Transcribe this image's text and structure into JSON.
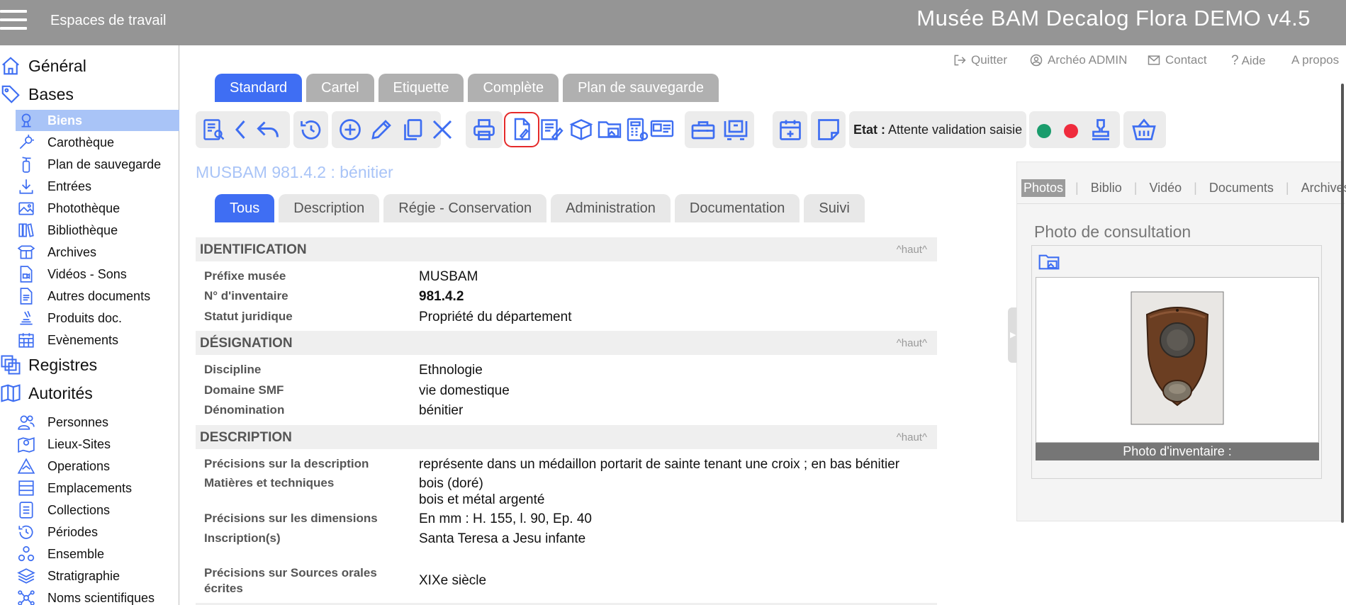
{
  "header": {
    "workspaces_label": "Espaces de travail",
    "app_title": "Musée BAM Decalog Flora DEMO v4.5"
  },
  "sidebar": {
    "general": "Général",
    "bases": "Bases",
    "bases_items": [
      "Biens",
      "Carothèque",
      "Plan de sauvegarde",
      "Entrées",
      "Photothèque",
      "Bibliothèque",
      "Archives",
      "Vidéos - Sons",
      "Autres documents",
      "Produits doc.",
      "Evènements"
    ],
    "registres": "Registres",
    "autorites": "Autorités",
    "autorites_items": [
      "Personnes",
      "Lieux-Sites",
      "Operations",
      "Emplacements",
      "Collections",
      "Périodes",
      "Ensemble",
      "Stratigraphie",
      "Noms scientifiques"
    ],
    "active_item": "Biens"
  },
  "toplinks": {
    "quit": "Quitter",
    "user": "Archéo ADMIN",
    "contact": "Contact",
    "help": "Aide",
    "about": "A propos"
  },
  "main_tabs": [
    "Standard",
    "Cartel",
    "Etiquette",
    "Complète",
    "Plan de sauvegarde"
  ],
  "main_tab_active": "Standard",
  "etat": {
    "label": "Etat :",
    "value": "Attente validation saisie"
  },
  "status_colors": {
    "green": "#1a9c6c",
    "red": "#ef2b3d",
    "accent": "#3f6ef3"
  },
  "record_title": "MUSBAM 981.4.2 : bénitier",
  "sub_tabs": [
    "Tous",
    "Description",
    "Régie - Conservation",
    "Administration",
    "Documentation",
    "Suivi"
  ],
  "sub_tab_active": "Tous",
  "haut_label": "^haut^",
  "sections": {
    "identification": {
      "title": "IDENTIFICATION",
      "rows": [
        {
          "label": "Préfixe musée",
          "value": "MUSBAM"
        },
        {
          "label": "N° d'inventaire",
          "value": "981.4.2"
        },
        {
          "label": "Statut juridique",
          "value": "Propriété du département"
        }
      ]
    },
    "designation": {
      "title": "DÉSIGNATION",
      "rows": [
        {
          "label": "Discipline",
          "value": "Ethnologie"
        },
        {
          "label": "Domaine SMF",
          "value": "vie domestique"
        },
        {
          "label": "Dénomination",
          "value": "bénitier"
        }
      ]
    },
    "description": {
      "title": "DESCRIPTION",
      "rows": [
        {
          "label": "Précisions sur la description",
          "value": "représente dans un médaillon portarit de sainte tenant une croix ; en bas bénitier"
        },
        {
          "label": "Matières et techniques",
          "value": "bois (doré)",
          "value2": "bois et métal argenté"
        },
        {
          "label": "Précisions sur les dimensions",
          "value": "En mm : H. 155, l. 90, Ep. 40"
        },
        {
          "label": "Inscription(s)",
          "value": "Santa Teresa a Jesu infante"
        },
        {
          "label": "Précisions sur Sources orales écrites",
          "value": "XIXe siècle"
        }
      ]
    }
  },
  "right_panel": {
    "tabs": [
      "Photos",
      "Biblio",
      "Vidéo",
      "Documents",
      "Archives"
    ],
    "active_tab": "Photos",
    "photo_title": "Photo de consultation",
    "photo_caption": "Photo d'inventaire :"
  }
}
